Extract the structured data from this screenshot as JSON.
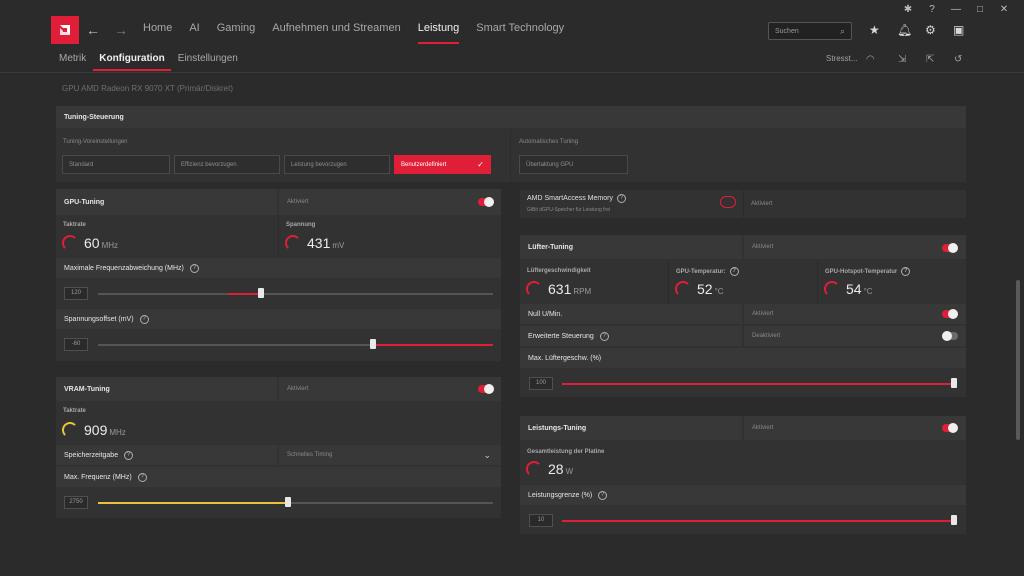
{
  "topnav": {
    "links": [
      "Home",
      "AI",
      "Gaming",
      "Aufnehmen und Streamen",
      "Leistung",
      "Smart Technology"
    ],
    "active": "Leistung",
    "search_placeholder": "Suchen"
  },
  "subnav": {
    "tabs": [
      "Metrik",
      "Konfiguration",
      "Einstellungen"
    ],
    "active": "Konfiguration",
    "right_label": "Stresst..."
  },
  "gpu_line": "GPU    AMD Radeon RX 9070 XT (Primär/Diskret)",
  "tuning_control": {
    "title": "Tuning-Steuerung",
    "presets_label": "Tuning-Voreinstellungen",
    "presets": [
      "Standard",
      "Effizienz bevorzugen",
      "Leistung bevorzugen",
      "Benutzerdefiniert"
    ],
    "active_preset": "Benutzerdefiniert",
    "auto_label": "Automatisches Tuning",
    "auto_button": "Übertaktung GPU"
  },
  "gpu_tuning": {
    "title": "GPU-Tuning",
    "status": "Aktiviert",
    "clock_label": "Taktrate",
    "clock_value": "60",
    "clock_unit": "MHz",
    "voltage_label": "Spannung",
    "voltage_value": "431",
    "voltage_unit": "mV",
    "freq_dev_label": "Maximale Frequenzabweichung (MHz)",
    "freq_dev_value": "120",
    "voltage_offset_label": "Spannungsoffset (mV)",
    "voltage_offset_value": "-60"
  },
  "vram_tuning": {
    "title": "VRAM-Tuning",
    "status": "Aktiviert",
    "clock_label": "Taktrate",
    "clock_value": "909",
    "clock_unit": "MHz",
    "timing_label": "Speicherzeitgabe",
    "timing_value": "Schnelles Timing",
    "max_freq_label": "Max. Frequenz (MHz)",
    "max_freq_value": "2750"
  },
  "sam": {
    "title": "AMD SmartAccess Memory",
    "desc": "GiBit dGPU-Speicher für Leistung frei",
    "status": "Aktiviert"
  },
  "fan_tuning": {
    "title": "Lüfter-Tuning",
    "status": "Aktiviert",
    "speed_label": "Lüftergeschwindigkeit",
    "speed_value": "631",
    "speed_unit": "RPM",
    "temp_label": "GPU-Temperatur:",
    "temp_value": "52",
    "temp_unit": "°C",
    "hotspot_label": "GPU-Hotspot-Temperatur",
    "hotspot_value": "54",
    "hotspot_unit": "°C",
    "zero_rpm_label": "Null U/Min.",
    "zero_rpm_status": "Aktiviert",
    "advanced_label": "Erweiterte Steuerung",
    "advanced_status": "Deaktiviert",
    "max_speed_label": "Max. Lüftergeschw. (%)",
    "max_speed_value": "100"
  },
  "power_tuning": {
    "title": "Leistungs-Tuning",
    "status": "Aktiviert",
    "board_power_label": "Gesamtleistung der Platine",
    "board_power_value": "28",
    "board_power_unit": "W",
    "power_limit_label": "Leistungsgrenze (%)",
    "power_limit_value": "10"
  },
  "colors": {
    "accent": "#e01e37",
    "vram_accent": "#e8c33b",
    "bg": "#2b2b2b",
    "panel": "#323232"
  }
}
